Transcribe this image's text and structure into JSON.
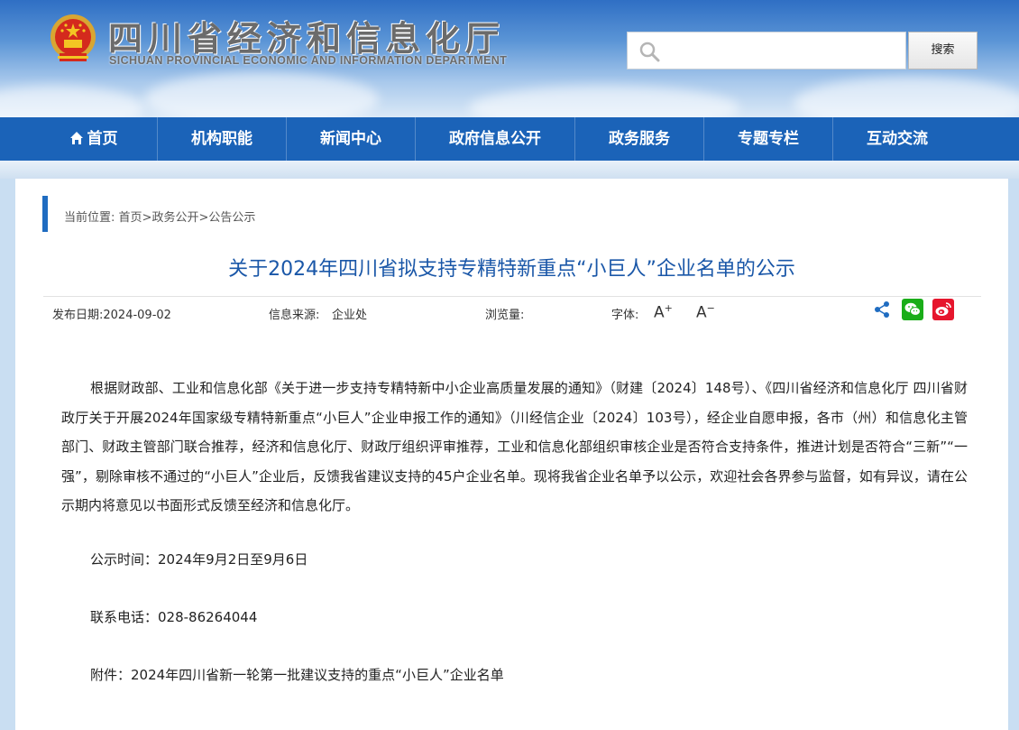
{
  "header": {
    "title": "四川省经济和信息化厅",
    "subtitle": "SICHUAN PROVINCIAL ECONOMIC AND INFORMATION DEPARTMENT",
    "search_placeholder": "",
    "search_button": "搜索"
  },
  "nav": {
    "items": [
      {
        "label": "首页"
      },
      {
        "label": "机构职能"
      },
      {
        "label": "新闻中心"
      },
      {
        "label": "政府信息公开"
      },
      {
        "label": "政务服务"
      },
      {
        "label": "专题专栏"
      },
      {
        "label": "互动交流"
      }
    ]
  },
  "breadcrumb": {
    "prefix": "当前位置: ",
    "items": [
      "首页",
      "政务公开",
      "公告公示"
    ],
    "separator": ">"
  },
  "article": {
    "title": "关于2024年四川省拟支持专精特新重点“小巨人”企业名单的公示",
    "meta": {
      "date": "发布日期:2024-09-02",
      "source_label": "信息来源:",
      "source": "企业处",
      "views": "浏览量:",
      "font_label": "字体:",
      "font_larger": "A",
      "font_smaller": "A"
    },
    "body": "根据财政部、工业和信息化部《关于进一步支持专精特新中小企业高质量发展的通知》（财建〔2024〕148号）、《四川省经济和信息化厅 四川省财政厅关于开展2024年国家级专精特新重点“小巨人”企业申报工作的通知》（川经信企业〔2024〕103号），经企业自愿申报，各市（州）和信息化主管部门、财政主管部门联合推荐，经济和信息化厅、财政厅组织评审推荐，工业和信息化部组织审核企业是否符合支持条件，推进计划是否符合“三新”“一强”，剔除审核不通过的“小巨人”企业后，反馈我省建议支持的45户企业名单。现将我省企业名单予以公示，欢迎社会各界参与监督，如有异议，请在公示期内将意见以书面形式反馈至经济和信息化厅。",
    "period": "公示时间：2024年9月2日至9月6日",
    "phone": "联系电话：028-86264044",
    "attachment": "附件：2024年四川省新一轮第一批建议支持的重点“小巨人”企业名单"
  },
  "colors": {
    "nav_bg": "#1b63b8",
    "title_blue": "#1a57a8",
    "wechat_green": "#1aad19",
    "weibo_red": "#e6162d"
  }
}
